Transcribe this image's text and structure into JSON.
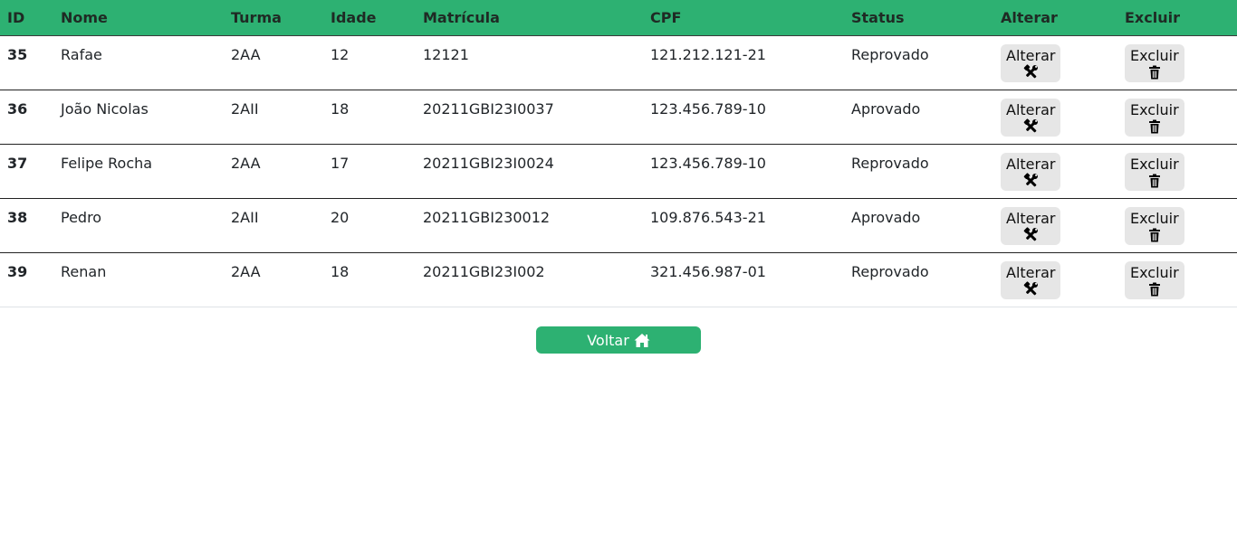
{
  "table": {
    "headers": {
      "id": "ID",
      "nome": "Nome",
      "turma": "Turma",
      "idade": "Idade",
      "matricula": "Matrícula",
      "cpf": "CPF",
      "status": "Status",
      "alterar": "Alterar",
      "excluir": "Excluir"
    },
    "rows": [
      {
        "id": "35",
        "nome": "Rafae",
        "turma": "2AA",
        "idade": "12",
        "matricula": "12121",
        "cpf": "121.212.121-21",
        "status": "Reprovado",
        "alterar_label": "Alterar",
        "excluir_label": "Excluir"
      },
      {
        "id": "36",
        "nome": "João Nicolas",
        "turma": "2AII",
        "idade": "18",
        "matricula": "20211GBI23I0037",
        "cpf": "123.456.789-10",
        "status": "Aprovado",
        "alterar_label": "Alterar",
        "excluir_label": "Excluir"
      },
      {
        "id": "37",
        "nome": "Felipe Rocha",
        "turma": "2AA",
        "idade": "17",
        "matricula": "20211GBI23I0024",
        "cpf": "123.456.789-10",
        "status": "Reprovado",
        "alterar_label": "Alterar",
        "excluir_label": "Excluir"
      },
      {
        "id": "38",
        "nome": "Pedro",
        "turma": "2AII",
        "idade": "20",
        "matricula": "20211GBI230012",
        "cpf": "109.876.543-21",
        "status": "Aprovado",
        "alterar_label": "Alterar",
        "excluir_label": "Excluir"
      },
      {
        "id": "39",
        "nome": "Renan",
        "turma": "2AA",
        "idade": "18",
        "matricula": "20211GBI23I002",
        "cpf": "321.456.987-01",
        "status": "Reprovado",
        "alterar_label": "Alterar",
        "excluir_label": "Excluir"
      }
    ],
    "alterar_icon": "tools-icon",
    "excluir_icon": "trash-icon"
  },
  "footer": {
    "voltar_label": "Voltar",
    "voltar_icon": "home-icon"
  },
  "colors": {
    "accent": "#2db172",
    "button_bg": "#e6e6e6"
  }
}
